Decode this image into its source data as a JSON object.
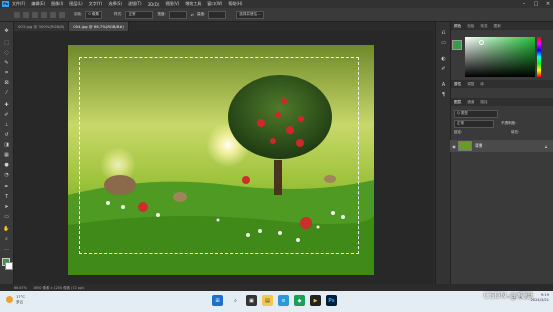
{
  "menubar": {
    "app_icon": "photoshop-logo",
    "app_abbr": "Ps",
    "items": [
      "文件(F)",
      "编辑(E)",
      "图像(I)",
      "图层(L)",
      "文字(Y)",
      "选择(S)",
      "滤镜(T)",
      "3D(D)",
      "视图(V)",
      "增效工具",
      "窗口(W)",
      "帮助(H)"
    ]
  },
  "options": {
    "feather_label": "羽化:",
    "feather_value": "0 像素",
    "style_label": "样式:",
    "style_value": "正常",
    "width_label": "宽度:",
    "height_label": "高度:",
    "select_mask_button": "选择并遮住..."
  },
  "tabs": [
    {
      "label": "003.jpg @ 300%(RGB/8)",
      "active": false
    },
    {
      "label": "004.jpg @ 66.7%(RGB/8#)",
      "active": true
    }
  ],
  "panels": {
    "color_tabs": [
      "颜色",
      "色板",
      "渐变",
      "图案"
    ],
    "adjust_tabs": [
      "属性",
      "调整",
      "库"
    ],
    "layers_tabs": [
      "图层",
      "通道",
      "路径"
    ],
    "layer_kind": "Q 类型",
    "blend_mode": "正常",
    "opacity_label": "不透明度:",
    "lock_label": "锁定:",
    "fill_label": "填充:",
    "layer_name": "背景",
    "accent_color": "#3a9a4a"
  },
  "status": {
    "zoom": "66.67%",
    "doc_info": "1600 像素 x 1200 像素 (72 ppi)"
  },
  "taskbar": {
    "temp": "17°C",
    "weather": "多云",
    "tray_lang": "中",
    "time": "9:19",
    "date": "2024/3/21",
    "watermark": "CSDN @权重"
  }
}
